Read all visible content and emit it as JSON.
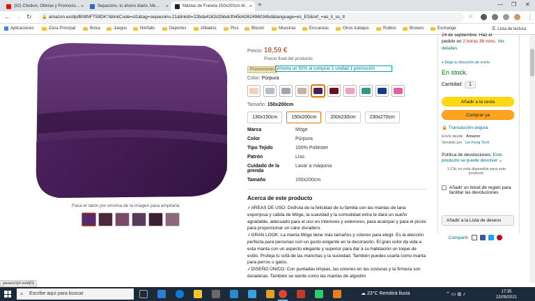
{
  "browser": {
    "tabs": [
      {
        "title": "(82) Choikos, Ofertas y Promocio…",
        "favicon_color": "#ff0000"
      },
      {
        "title": "Sepacoins, tu ahorro diario. Me…",
        "favicon_color": "#2a6ad1"
      },
      {
        "title": "Mantas de Franela 150x200cm M…",
        "favicon_color": "#222222"
      }
    ],
    "url": "amazon.es/dp/B08NFT59DK?&linkCode=sl1&tag=sepacoins-21&linkId=22bda4182d2bbdcf045d4262496034bd&language=es_ES&ref_=as_li_ss_tl",
    "bookmarks": [
      "Aplicaciones",
      "Zona Principal",
      "Bolsa",
      "Juegos",
      "Nimfalls",
      "Deportes",
      "Afiliados",
      "Ptcs",
      "Bitcoin",
      "Muestras",
      "Encuestas",
      "Otros trabajos",
      "Rublos",
      "Brokers",
      "Exchange"
    ],
    "reading_list": "Lista de lectura",
    "status_text": "javascript:void(0)"
  },
  "product": {
    "hover_hint": "Pasa el ratón por encima de la imagen para ampliarla",
    "price_label": "Precio:",
    "price": "18,59 €",
    "price_final": "Precio final del producto",
    "promo_badge": "Promociones",
    "promo_text": "Ahorra un 50% al comprar 1 unidad      1 promoción",
    "color_label": "Color:",
    "color_value": "Púrpura",
    "swatch_colors": [
      "#f3d0b8",
      "#b9bcc4",
      "#a0a6b0",
      "#c8b0a0",
      "#4a1f5c",
      "#6a1020",
      "#f0a0c0",
      "#2a9a8a",
      "#1a3a8a",
      "#e060a0"
    ],
    "size_label": "Tamaño:",
    "size_value": "150x200cm",
    "sizes": [
      "130x150cm",
      "150x200cm",
      "200x230cm",
      "230x270cm"
    ],
    "specs": [
      {
        "k": "Marca",
        "v": "Möge"
      },
      {
        "k": "Color",
        "v": "Púrpura"
      },
      {
        "k": "Tipo Tejido",
        "v": "100% Poliéster"
      },
      {
        "k": "Patrón",
        "v": "Liso"
      },
      {
        "k": "Cuidado de la prenda",
        "v": "Lavar a máquina"
      },
      {
        "k": "Tamaño",
        "v": "150x200cm"
      }
    ],
    "about_title": "Acerca de este producto",
    "about": [
      "✓AREAS DE USO: Disfruta de la felicidad de tu familia con las mantas de lana esponjosa y cálida de Möge, la suavidad y la comodidad extra te dará un sueño agradable, adecuado para el uso en interiores y exteriores, para acampar y para el picnic para proporcionar un calor duradero.",
      "✓GRAN LOOK: La manta Möge tiene más tamaños y colores para elegir. Es la elección perfecta para personas con un gusto exigente en la decoración. El gran color da vida a esta manta con un aspecto elegante y superior para dar a su habitación un toque de estilo. Proteja tu sofá de las manchas y la suciedad. También puedes usarla como manta para perros o gatos.",
      "✓DISEÑO ÚNICO: Con puntadas limpias, las uniones en las costuras y la firmeza son duraderas. También se siente como las mantas de algodón"
    ]
  },
  "buybox": {
    "delivery_top": "24 de septiembre. Haz el",
    "delivery_line2a": "pedido en ",
    "delivery_line2b": "2 horas 38 mins.",
    "delivery_line2c": " Ver",
    "delivery_line3": "detalles",
    "address": "Elige tu dirección de envío",
    "stock": "En stock.",
    "qty_label": "Cantidad:",
    "qty_value": "1",
    "add_cart": "Añadir a la cesta",
    "buy_now": "Comprar ya",
    "secure": "Transacción segura",
    "ship_from_label": "Envío desde",
    "ship_from": "Amazon",
    "sold_by_label": "Vendido por",
    "sold_by": "Lin Feng Tech",
    "returns_label": "Política de devoluciones:",
    "returns_link": "Este producto se puede devolver",
    "oneclick": "1-Clic no está disponible para este producto.",
    "gift": "Añadir un ticket de regalo para facilitar las devoluciones",
    "wishlist": "Añadir a la Lista de deseos",
    "share": "Compartir"
  },
  "taskbar": {
    "search": "Escribe aquí para buscar",
    "weather": "23°C  Remitirá lluvia",
    "time": "17:35",
    "date": "22/09/2021"
  }
}
